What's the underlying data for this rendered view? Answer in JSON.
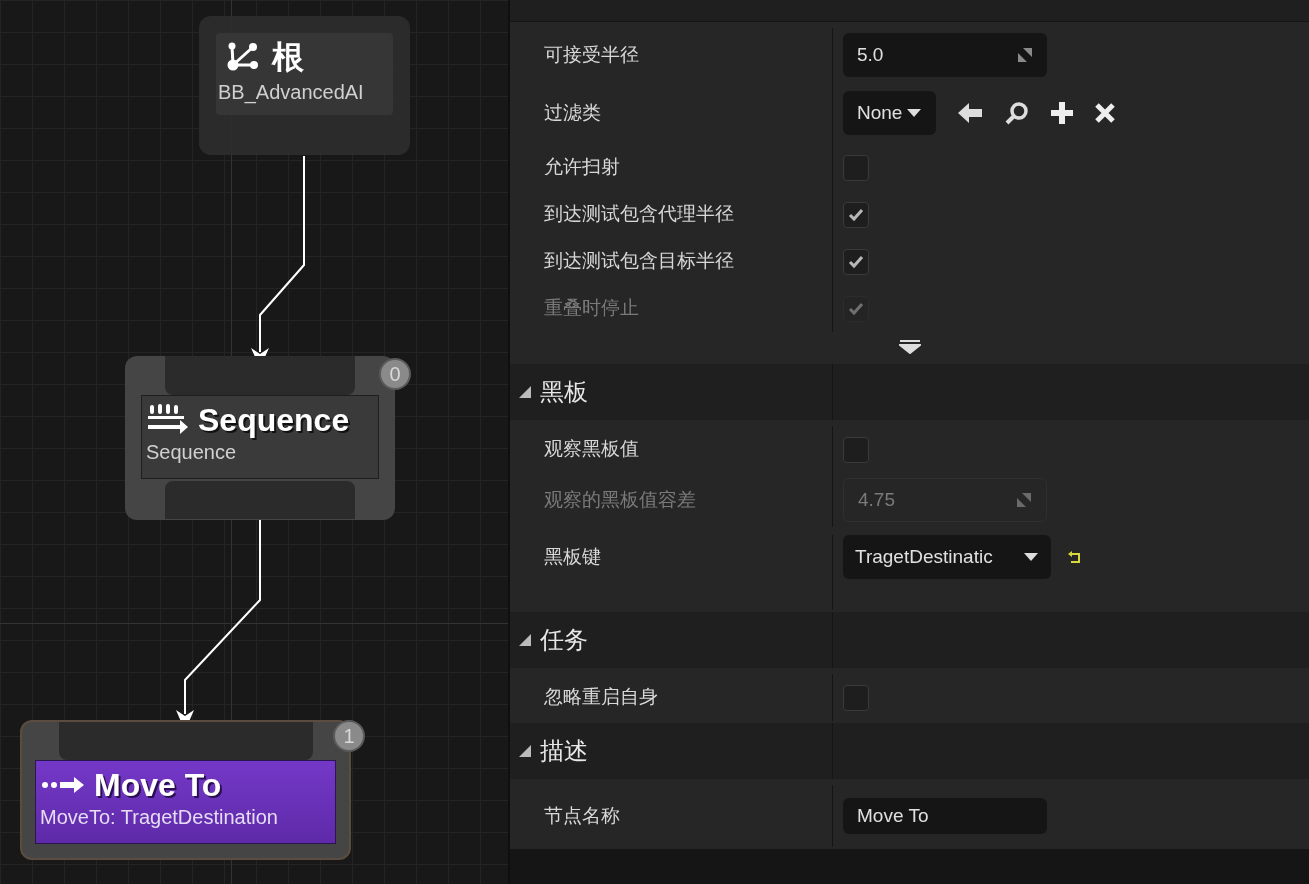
{
  "graph": {
    "nodes": [
      {
        "kind": "root",
        "title": "根",
        "subtitle": "BB_AdvancedAI"
      },
      {
        "kind": "composite",
        "title": "Sequence",
        "subtitle": "Sequence",
        "index": "0"
      },
      {
        "kind": "task",
        "title": "Move To",
        "subtitle": "MoveTo: TragetDestination",
        "index": "1"
      }
    ]
  },
  "details": {
    "sections": [
      {
        "expanded": true,
        "advanced_toggle": true,
        "rows": [
          {
            "kind": "number",
            "label": "可接受半径",
            "value": "5.0",
            "disabled": false
          },
          {
            "kind": "class_picker",
            "label": "过滤类",
            "value": "None"
          },
          {
            "kind": "checkbox",
            "label": "允许扫射",
            "checked": false,
            "disabled": false
          },
          {
            "kind": "checkbox",
            "label": "到达测试包含代理半径",
            "checked": true,
            "disabled": false
          },
          {
            "kind": "checkbox",
            "label": "到达测试包含目标半径",
            "checked": true,
            "disabled": false
          },
          {
            "kind": "checkbox",
            "label": "重叠时停止",
            "checked": true,
            "disabled": true
          }
        ]
      },
      {
        "title": "黑板",
        "expanded": true,
        "rows": [
          {
            "kind": "checkbox",
            "label": "观察黑板值",
            "checked": false,
            "disabled": false
          },
          {
            "kind": "number",
            "label": "观察的黑板值容差",
            "value": "4.75",
            "disabled": true
          },
          {
            "kind": "key",
            "label": "黑板键",
            "value": "TragetDestinatic",
            "modified": true
          }
        ]
      },
      {
        "title": "任务",
        "expanded": true,
        "rows": [
          {
            "kind": "checkbox",
            "label": "忽略重启自身",
            "checked": false,
            "disabled": false
          }
        ]
      },
      {
        "title": "描述",
        "expanded": true,
        "rows": [
          {
            "kind": "text",
            "label": "节点名称",
            "value": "Move To"
          }
        ]
      }
    ]
  }
}
